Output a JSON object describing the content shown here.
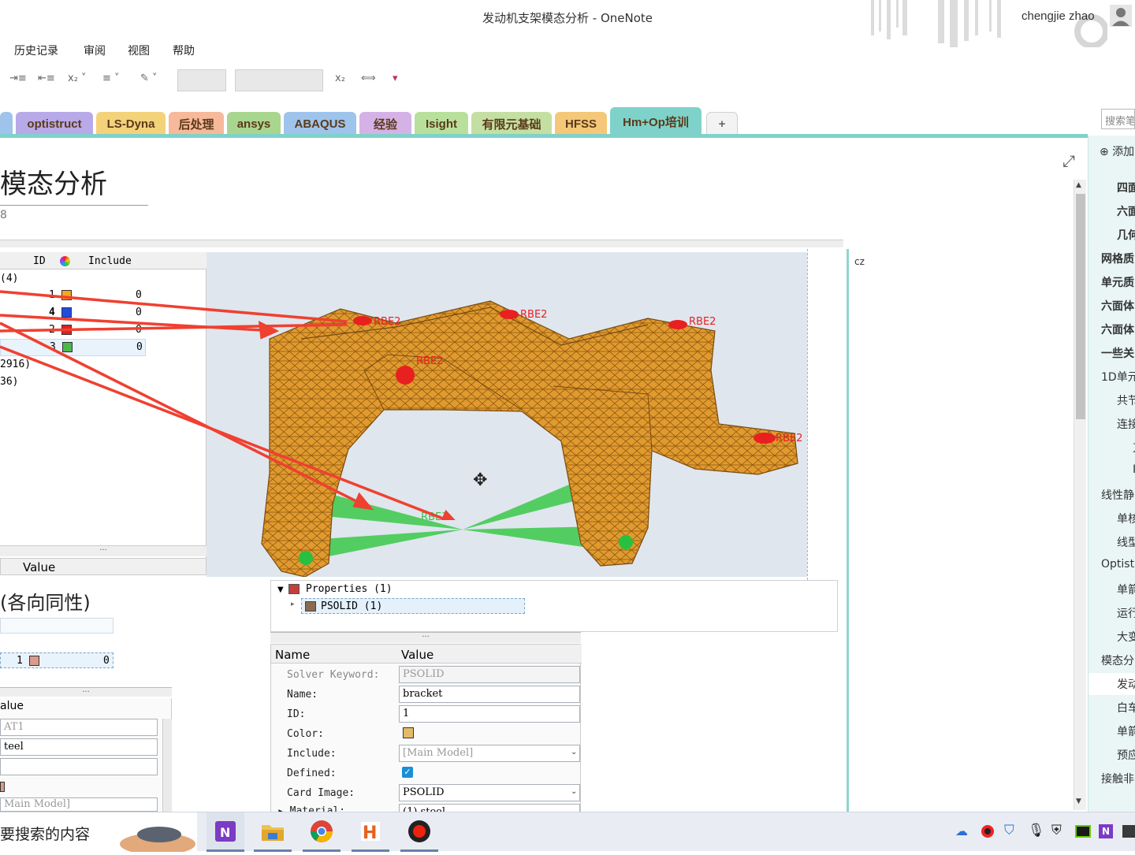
{
  "window": {
    "title": "发动机支架模态分析 - OneNote",
    "user": "chengjie zhao"
  },
  "menu": [
    "历史记录",
    "审阅",
    "视图",
    "帮助"
  ],
  "tabs": [
    {
      "label": "optistruct",
      "color": "#b8a9e8"
    },
    {
      "label": "LS-Dyna",
      "color": "#f3d27a"
    },
    {
      "label": "后处理",
      "color": "#f6b99a"
    },
    {
      "label": "ansys",
      "color": "#a9d68f"
    },
    {
      "label": "ABAQUS",
      "color": "#9fc4ec"
    },
    {
      "label": "经验",
      "color": "#d5b2e6"
    },
    {
      "label": "Isight",
      "color": "#b8e09c"
    },
    {
      "label": "有限元基础",
      "color": "#c4dfa2"
    },
    {
      "label": "HFSS",
      "color": "#f4c878"
    },
    {
      "label": "Hm+Op培训",
      "color": "#7fd2c9"
    },
    {
      "label": "+",
      "color": "#f3f3f3"
    }
  ],
  "search": {
    "placeholder": "搜索笔"
  },
  "page": {
    "title": "模态分析",
    "date": "8",
    "note_label": "cz"
  },
  "component_table": {
    "headers": [
      "ID",
      "Include"
    ],
    "group_label": "(4)",
    "rows": [
      {
        "id": "1",
        "color": "#f5a623",
        "include": "0"
      },
      {
        "id": "4",
        "color": "#1f4de0",
        "include": "0"
      },
      {
        "id": "2",
        "color": "#e02020",
        "include": "0"
      },
      {
        "id": "3",
        "color": "#4cb84c",
        "include": "0"
      }
    ],
    "extra": [
      "2916)",
      "36)"
    ],
    "value_header": "Value"
  },
  "material_panel": {
    "title": "(各向同性)",
    "row": {
      "id": "1",
      "include": "0",
      "color": "#d99b8e"
    },
    "value_header": "alue",
    "values": [
      "AT1",
      "teel",
      "",
      "",
      "Main Model]"
    ]
  },
  "model": {
    "labels": [
      "RBE2",
      "RBE2",
      "RBE2",
      "RBE2",
      "RBE2",
      "RBE3"
    ]
  },
  "properties_tree": {
    "root": "Properties (1)",
    "child": "PSOLID (1)"
  },
  "prop_table": {
    "headers": [
      "Name",
      "Value"
    ],
    "rows": [
      {
        "name": "Solver Keyword:",
        "value": "PSOLID",
        "disabled": true
      },
      {
        "name": "Name:",
        "value": "bracket"
      },
      {
        "name": "ID:",
        "value": "1"
      },
      {
        "name": "Color:",
        "value": ""
      },
      {
        "name": "Include:",
        "value": "[Main Model]",
        "disabled": true
      },
      {
        "name": "Defined:",
        "value": ""
      },
      {
        "name": "Card Image:",
        "value": "PSOLID"
      },
      {
        "name": "Material:",
        "value": "(1) steel"
      }
    ]
  },
  "sidebar": {
    "add_label": "添加",
    "items": [
      "四面",
      "六面",
      "几何",
      "网格质",
      "单元质",
      "六面体",
      "六面体",
      "一些关",
      "1D单元",
      "共节",
      "连接",
      "刀",
      "I",
      "线性静",
      "单核",
      "线型",
      "Optist",
      "单箭",
      "运行",
      "大变",
      "模态分",
      "发动",
      "白车",
      "单箭",
      "预应",
      "接触非"
    ]
  },
  "taskbar": {
    "search_text": "要搜索的内容"
  }
}
